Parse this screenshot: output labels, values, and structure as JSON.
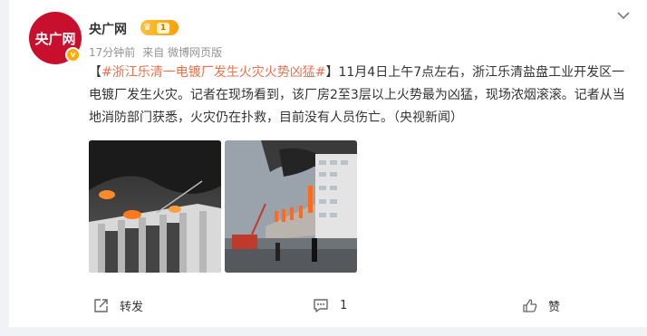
{
  "post": {
    "author": "央广网",
    "avatar_text": "央广网",
    "verified_mark": "v",
    "vip_level": "1",
    "time": "17分钟前",
    "source": "来自 微博网页版",
    "text_open": "【",
    "topic": "#浙江乐清一电镀厂发生火灾火势凶猛#",
    "text_body": "】11月4日上午7点左右，浙江乐清盐盘工业开发区一电镀厂发生火灾。记者在现场看到，该厂房2至3层以上火势最为凶猛，现场浓烟滚滚。记者从当地消防部门获悉，火灾仍在扑救，目前没有人员伤亡。（央视新闻）",
    "images": [
      {
        "icon": "fire-building-photo-1"
      },
      {
        "icon": "fire-building-photo-2"
      }
    ]
  },
  "actions": {
    "repost_label": "转发",
    "comment_count": "1",
    "like_label": "赞"
  },
  "colors": {
    "topic": "#eb7350",
    "brand": "#c8102e",
    "verify": "#ffab00"
  }
}
